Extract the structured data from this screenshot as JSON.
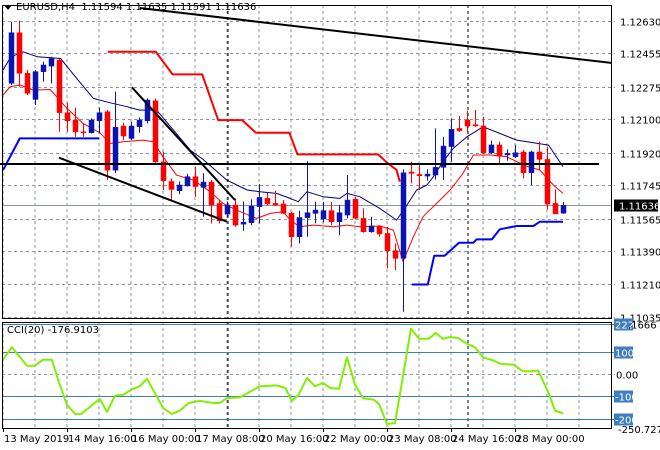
{
  "header": {
    "symbol": "EURUSD,H4",
    "open": "1.11594",
    "high": "1.11635",
    "low": "1.11591",
    "close": "1.11636"
  },
  "cci_header": {
    "label": "CCI(20)",
    "value": "-176.9103"
  },
  "colors": {
    "bull": "#0a14b4",
    "bear": "#ff0000",
    "resistance": "#ff0000",
    "support": "#0000ff",
    "ma_upper": "#00007a",
    "ma": "#ff0000",
    "cci": "#80f000",
    "level": "#3f7fbf",
    "grid": "#8a95a0"
  },
  "chart_data": [
    {
      "type": "candlestick",
      "title": "EURUSD,H4",
      "price_axis": {
        "ticks": [
          "1.12630",
          "1.12455",
          "1.12275",
          "1.12100",
          "1.11920",
          "1.11745",
          "1.11565",
          "1.11390",
          "1.11210",
          "1.11035"
        ],
        "range": [
          1.11029,
          1.12716
        ]
      },
      "current_price": "1.11636",
      "time_axis": {
        "labels": [
          "13 May 2019",
          "14 May 16:00",
          "16 May 00:00",
          "17 May 08:00",
          "20 May 16:00",
          "22 May 00:00",
          "23 May 08:00",
          "24 May 16:00",
          "28 May 00:00"
        ],
        "bars_per_label": 4
      },
      "period_separators_at_bar": [
        27,
        57
      ],
      "ohlc": [
        [
          1.12294,
          1.12626,
          1.12285,
          1.12567
        ],
        [
          1.12567,
          1.12632,
          1.12276,
          1.12348
        ],
        [
          1.12348,
          1.12366,
          1.12231,
          1.1224
        ],
        [
          1.12207,
          1.12366,
          1.12177,
          1.12357
        ],
        [
          1.12357,
          1.12411,
          1.12303,
          1.12393
        ],
        [
          1.12387,
          1.12437,
          1.12294,
          1.12428
        ],
        [
          1.12419,
          1.12428,
          1.12033,
          1.12136
        ],
        [
          1.12136,
          1.12189,
          1.12033,
          1.12092
        ],
        [
          1.12096,
          1.12164,
          1.12006,
          1.12033
        ],
        [
          1.12033,
          1.12078,
          1.12006,
          1.12028
        ],
        [
          1.12028,
          1.12105,
          1.12024,
          1.12096
        ],
        [
          1.12092,
          1.12164,
          1.12024,
          1.12136
        ],
        [
          1.12141,
          1.1215,
          1.11773,
          1.11826
        ],
        [
          1.11826,
          1.12249,
          1.1181,
          1.12057
        ],
        [
          1.12064,
          1.12082,
          1.11988,
          1.1201
        ],
        [
          1.11997,
          1.12087,
          1.11988,
          1.12064
        ],
        [
          1.1206,
          1.1211,
          1.12028,
          1.12096
        ],
        [
          1.12092,
          1.12213,
          1.12078,
          1.12204
        ],
        [
          1.122,
          1.12213,
          1.11866,
          1.11871
        ],
        [
          1.11871,
          1.11925,
          1.11719,
          1.11769
        ],
        [
          1.11765,
          1.11782,
          1.11665,
          1.11722
        ],
        [
          1.11715,
          1.11764,
          1.11697,
          1.11746
        ],
        [
          1.11741,
          1.11806,
          1.11738,
          1.11791
        ],
        [
          1.11791,
          1.11845,
          1.11683,
          1.11738
        ],
        [
          1.11733,
          1.1181,
          1.11575,
          1.11762
        ],
        [
          1.11762,
          1.11773,
          1.11539,
          1.11638
        ],
        [
          1.11647,
          1.11665,
          1.11539,
          1.11553
        ],
        [
          1.11589,
          1.11657,
          1.11575,
          1.11638
        ],
        [
          1.11638,
          1.11674,
          1.11521,
          1.1153
        ],
        [
          1.11535,
          1.11657,
          1.11499,
          1.11546
        ],
        [
          1.11543,
          1.11669,
          1.1153,
          1.11632
        ],
        [
          1.11629,
          1.11751,
          1.11539,
          1.11679
        ],
        [
          1.11674,
          1.11704,
          1.11638,
          1.11644
        ],
        [
          1.11647,
          1.11715,
          1.11632,
          1.11638
        ],
        [
          1.11644,
          1.11665,
          1.11589,
          1.11594
        ],
        [
          1.11594,
          1.11602,
          1.11413,
          1.11467
        ],
        [
          1.11467,
          1.11607,
          1.11431,
          1.11571
        ],
        [
          1.1157,
          1.11875,
          1.11467,
          1.11597
        ],
        [
          1.11593,
          1.11656,
          1.11539,
          1.11611
        ],
        [
          1.11563,
          1.11656,
          1.11543,
          1.11608
        ],
        [
          1.11608,
          1.11654,
          1.1153,
          1.11548
        ],
        [
          1.11548,
          1.11638,
          1.11476,
          1.11597
        ],
        [
          1.11584,
          1.118,
          1.11566,
          1.11665
        ],
        [
          1.11669,
          1.11683,
          1.11561,
          1.11566
        ],
        [
          1.11566,
          1.1162,
          1.11489,
          1.11494
        ],
        [
          1.11494,
          1.11575,
          1.11489,
          1.11525
        ],
        [
          1.11525,
          1.1153,
          1.11467,
          1.11482
        ],
        [
          1.11485,
          1.11521,
          1.11297,
          1.11392
        ],
        [
          1.11392,
          1.11431,
          1.11288,
          1.11351
        ],
        [
          1.11351,
          1.1183,
          1.11063,
          1.11812
        ],
        [
          1.11816,
          1.11872,
          1.11755,
          1.11809
        ],
        [
          1.11803,
          1.11854,
          1.11719,
          1.11796
        ],
        [
          1.11794,
          1.1183,
          1.11769,
          1.11805
        ],
        [
          1.118,
          1.12051,
          1.11776,
          1.11841
        ],
        [
          1.11841,
          1.12006,
          1.11773,
          1.11956
        ],
        [
          1.11953,
          1.12105,
          1.11872,
          1.12046
        ],
        [
          1.12051,
          1.12118,
          1.12033,
          1.12039
        ],
        [
          1.12096,
          1.12147,
          1.12028,
          1.12064
        ],
        [
          1.12071,
          1.1215,
          1.1206,
          1.12064
        ],
        [
          1.12064,
          1.12114,
          1.11913,
          1.1192
        ],
        [
          1.1192,
          1.11985,
          1.11913,
          1.11962
        ],
        [
          1.11962,
          1.1198,
          1.11863,
          1.11902
        ],
        [
          1.11908,
          1.11938,
          1.11877,
          1.11917
        ],
        [
          1.11899,
          1.11962,
          1.1189,
          1.1192
        ],
        [
          1.11924,
          1.11935,
          1.11782,
          1.11812
        ],
        [
          1.11812,
          1.11931,
          1.11746,
          1.11924
        ],
        [
          1.11924,
          1.1198,
          1.11827,
          1.11884
        ],
        [
          1.11884,
          1.11953,
          1.11615,
          1.11643
        ],
        [
          1.11647,
          1.11723,
          1.1159,
          1.1159
        ],
        [
          1.11594,
          1.11655,
          1.11591,
          1.11636
        ]
      ],
      "ma_upper": [
        [
          -1,
          1.12366
        ],
        [
          0,
          1.12437
        ],
        [
          1.5,
          1.12464
        ],
        [
          3.3,
          1.12437
        ],
        [
          6.2,
          1.12428
        ],
        [
          8.2,
          1.12321
        ],
        [
          10.3,
          1.12213
        ],
        [
          12.4,
          1.12189
        ],
        [
          14.5,
          1.12168
        ],
        [
          16.1,
          1.1215
        ],
        [
          18.2,
          1.1215
        ],
        [
          20.3,
          1.12042
        ],
        [
          22.4,
          1.11934
        ],
        [
          24,
          1.11884
        ],
        [
          27,
          1.11772
        ],
        [
          29.5,
          1.11719
        ],
        [
          31.1,
          1.1171
        ],
        [
          33.2,
          1.11701
        ],
        [
          34.9,
          1.11674
        ],
        [
          35.9,
          1.11656
        ],
        [
          37,
          1.1171
        ],
        [
          39,
          1.11683
        ],
        [
          41.1,
          1.11674
        ],
        [
          42,
          1.11701
        ],
        [
          43.6,
          1.11683
        ],
        [
          46.1,
          1.1162
        ],
        [
          48.2,
          1.11557
        ],
        [
          49.5,
          1.11638
        ],
        [
          50.7,
          1.11719
        ],
        [
          52,
          1.11746
        ],
        [
          52.8,
          1.11791
        ],
        [
          54,
          1.11872
        ],
        [
          55.3,
          1.11944
        ],
        [
          57,
          1.12006
        ],
        [
          59,
          1.1206
        ],
        [
          61.1,
          1.12024
        ],
        [
          63.2,
          1.11988
        ],
        [
          65.3,
          1.11974
        ],
        [
          67.2,
          1.11961
        ],
        [
          69,
          1.11845
        ]
      ],
      "ma": [
        [
          -1,
          1.12231
        ],
        [
          -0.1,
          1.12276
        ],
        [
          1.1,
          1.12285
        ],
        [
          2.8,
          1.12258
        ],
        [
          4.9,
          1.12261
        ],
        [
          7,
          1.12159
        ],
        [
          9,
          1.12078
        ],
        [
          11.1,
          1.12028
        ],
        [
          12.4,
          1.1197
        ],
        [
          14,
          1.11979
        ],
        [
          16.5,
          1.11988
        ],
        [
          17.8,
          1.11979
        ],
        [
          19,
          1.11898
        ],
        [
          20.7,
          1.11799
        ],
        [
          22.8,
          1.11773
        ],
        [
          24.9,
          1.1171
        ],
        [
          26.5,
          1.11647
        ],
        [
          28.2,
          1.11611
        ],
        [
          30.7,
          1.11566
        ],
        [
          32.4,
          1.11593
        ],
        [
          34,
          1.11602
        ],
        [
          34.9,
          1.11557
        ],
        [
          36.1,
          1.11521
        ],
        [
          37.8,
          1.1153
        ],
        [
          40.3,
          1.11521
        ],
        [
          42,
          1.1153
        ],
        [
          43.6,
          1.11521
        ],
        [
          46.1,
          1.11525
        ],
        [
          47.8,
          1.11503
        ],
        [
          49,
          1.11333
        ],
        [
          50.3,
          1.11467
        ],
        [
          51.5,
          1.11575
        ],
        [
          53.2,
          1.11647
        ],
        [
          54.9,
          1.11719
        ],
        [
          56.5,
          1.11809
        ],
        [
          57.8,
          1.11908
        ],
        [
          59.9,
          1.11908
        ],
        [
          61.9,
          1.11899
        ],
        [
          64.4,
          1.11848
        ],
        [
          66.1,
          1.11827
        ],
        [
          67.8,
          1.11746
        ],
        [
          69,
          1.11701
        ]
      ],
      "resistance_step": [
        [
          12.1,
          1.12464
        ],
        [
          18.1,
          1.12464
        ],
        [
          20.2,
          1.12342
        ],
        [
          23.9,
          1.12342
        ],
        [
          25.9,
          1.12096
        ],
        [
          28.9,
          1.12096
        ],
        [
          30.6,
          1.12028
        ],
        [
          34.8,
          1.12028
        ],
        [
          35.8,
          1.11911
        ],
        [
          45.9,
          1.11911
        ],
        [
          47,
          1.11866
        ],
        [
          48.2,
          1.11827
        ],
        [
          48.6,
          1.11764
        ]
      ],
      "support_step": [
        [
          -1,
          1.11826
        ],
        [
          1.1,
          1.11997
        ],
        [
          11,
          1.11997
        ]
      ],
      "support_step_2": [
        [
          50.1,
          1.1121
        ],
        [
          52.1,
          1.1121
        ],
        [
          52.9,
          1.11365
        ],
        [
          54.2,
          1.11365
        ],
        [
          56,
          1.11435
        ],
        [
          57.8,
          1.11435
        ],
        [
          58.2,
          1.11453
        ],
        [
          60.1,
          1.11453
        ],
        [
          61.1,
          1.11507
        ],
        [
          63.2,
          1.11525
        ],
        [
          65.3,
          1.11525
        ],
        [
          66.1,
          1.11548
        ],
        [
          69,
          1.11548
        ]
      ],
      "trendlines": [
        {
          "name": "long-downtrend",
          "from": [
            16.1,
            1.127
          ],
          "to": [
            75.1,
            1.12404
          ]
        },
        {
          "name": "horizontal-level",
          "from": [
            -1.4,
            1.11859
          ],
          "to": [
            73.5,
            1.11859
          ]
        },
        {
          "name": "wedge-upper",
          "from": [
            15.1,
            1.12273
          ],
          "to": [
            28,
            1.11665
          ]
        },
        {
          "name": "wedge-lower",
          "from": [
            6,
            1.11893
          ],
          "to": [
            27,
            1.11548
          ]
        }
      ]
    },
    {
      "type": "line",
      "title": "CCI(20)",
      "current_value": "-176.9103",
      "range": [
        -250.727,
        222.1666
      ],
      "range_labels": [
        "222.1666",
        "-250.727"
      ],
      "levels": [
        "222",
        "100",
        "-100",
        "-200"
      ],
      "zero_label": "0.00",
      "points": [
        [
          -1,
          64
        ],
        [
          0.1,
          120
        ],
        [
          2,
          37
        ],
        [
          3,
          37
        ],
        [
          4.0,
          64
        ],
        [
          5.1,
          64
        ],
        [
          6.1,
          -48
        ],
        [
          7,
          -138
        ],
        [
          8,
          -179
        ],
        [
          8.8,
          -179
        ],
        [
          11.1,
          -111
        ],
        [
          12,
          -170
        ],
        [
          13,
          -97
        ],
        [
          14,
          -93
        ],
        [
          15.3,
          -66
        ],
        [
          16.1,
          -55
        ],
        [
          17,
          -21
        ],
        [
          19,
          -152
        ],
        [
          20.1,
          -179
        ],
        [
          21.1,
          -164
        ],
        [
          22.2,
          -130
        ],
        [
          23.6,
          -120
        ],
        [
          25.3,
          -130
        ],
        [
          26.1,
          -130
        ],
        [
          27,
          -108
        ],
        [
          28.6,
          -105
        ],
        [
          31.1,
          -55
        ],
        [
          33.2,
          -51
        ],
        [
          34.3,
          -63
        ],
        [
          35.1,
          -120
        ],
        [
          35.9,
          -96
        ],
        [
          37,
          -18
        ],
        [
          38,
          -55
        ],
        [
          39,
          -40
        ],
        [
          39.9,
          -63
        ],
        [
          41.0,
          -66
        ],
        [
          42,
          75
        ],
        [
          43,
          -48
        ],
        [
          44,
          -108
        ],
        [
          45.3,
          -115
        ],
        [
          46,
          -134
        ],
        [
          47,
          -224
        ],
        [
          48,
          -220
        ],
        [
          50,
          203
        ],
        [
          51,
          158
        ],
        [
          52.2,
          158
        ],
        [
          53.1,
          184
        ],
        [
          54,
          158
        ],
        [
          54.9,
          166
        ],
        [
          55.9,
          161
        ],
        [
          57,
          135
        ],
        [
          58,
          120
        ],
        [
          59,
          75
        ],
        [
          60.3,
          60
        ],
        [
          61.3,
          45
        ],
        [
          62.8,
          42
        ],
        [
          64,
          12
        ],
        [
          64.9,
          12
        ],
        [
          65.9,
          15
        ],
        [
          67.2,
          -85
        ],
        [
          68,
          -164
        ],
        [
          69,
          -177
        ]
      ]
    }
  ]
}
